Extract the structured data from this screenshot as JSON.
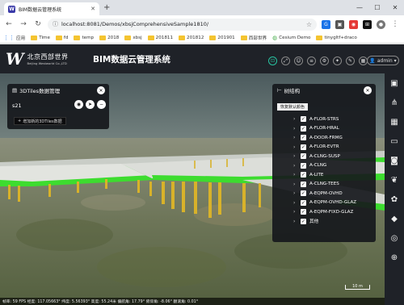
{
  "browser": {
    "tab_title": "BIM数据云管理系统",
    "url": "localhost:8081/Demos/xbsjComprehensiveSample1810/",
    "bookmarks": [
      "应用",
      "Time",
      "fd",
      "temp",
      "2018",
      "xbsj",
      "201811",
      "201812",
      "201901",
      "西部世界",
      "Cesium Demo",
      "tinygltf+draco"
    ]
  },
  "app": {
    "logo_w": "W",
    "logo_cn": "北京西部世界",
    "logo_en": "Beijing Westworld Co.,LTD",
    "title": "BIM数据云管理系统",
    "user": "admin"
  },
  "left_panel": {
    "title": "3DTiles数据管理",
    "item": "s21",
    "add_label": "增加新的3DTiles数据"
  },
  "right_panel": {
    "title": "树结构",
    "reset_label": "恢复默认颜色",
    "items": [
      "A-FLOR-STRS",
      "A-FLOR-HRAL",
      "A-DOOR-FRMG",
      "A-FLOR-EVTR",
      "A-CLNG-SUSP",
      "A-CLNG",
      "A-LITE",
      "A-CLNG-TEES",
      "A-EQPM-OVHD",
      "A-EQPM-OVHD-GLAZ",
      "A-EQPM-FIXD-GLAZ",
      "其他"
    ]
  },
  "status": "帧率: 59 FPS 经度: 117.05663° 纬度: 5.56393° 高度: 55.24米 偏航角: 17.79° 俯仰角: -8.06° 翻滚角: 0.01°",
  "scale_label": "10 m",
  "colors": {
    "accent": "#28c2a0",
    "header": "#1f2228",
    "bridge_green": "#3ddc2f"
  }
}
